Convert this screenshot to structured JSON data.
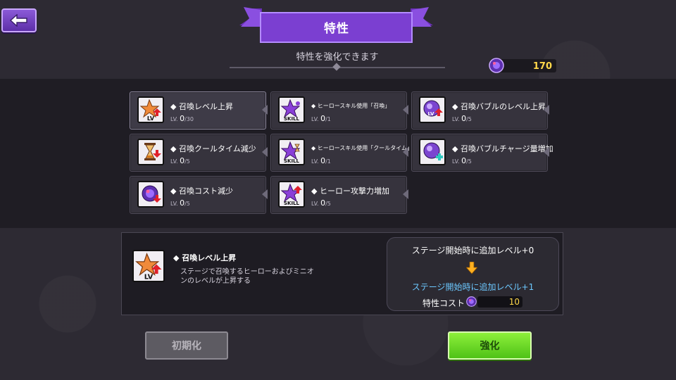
{
  "header": {
    "title": "特性",
    "subtitle": "特性を強化できます"
  },
  "currency": {
    "value": "170",
    "icon": "summon-orb-icon"
  },
  "traits": [
    {
      "name": "召喚レベル上昇",
      "lv_prefix": "LV.",
      "level": "0",
      "max": "/30",
      "icon": "orange-star-lv-icon",
      "selected": true
    },
    {
      "name": "ヒーロースキル使用「召喚」",
      "lv_prefix": "LV.",
      "level": "0",
      "max": "/1",
      "icon": "purple-star-skill-icon"
    },
    {
      "name": "召喚バブルのレベル上昇",
      "lv_prefix": "LV.",
      "level": "0",
      "max": "/5",
      "icon": "bubble-lv-icon"
    },
    {
      "name": "召喚クールタイム減少",
      "lv_prefix": "LV.",
      "level": "0",
      "max": "/5",
      "icon": "hourglass-icon"
    },
    {
      "name": "ヒーロースキル使用「クールタイム」",
      "lv_prefix": "LV.",
      "level": "0",
      "max": "/1",
      "icon": "purple-star-skill-hourglass-icon"
    },
    {
      "name": "召喚バブルチャージ量増加",
      "lv_prefix": "LV.",
      "level": "0",
      "max": "/5",
      "icon": "bubble-plus-icon"
    },
    {
      "name": "召喚コスト減少",
      "lv_prefix": "LV.",
      "level": "0",
      "max": "/5",
      "icon": "orb-down-icon"
    },
    {
      "name": "ヒーロー攻撃力増加",
      "lv_prefix": "LV.",
      "level": "0",
      "max": "/5",
      "icon": "purple-star-skill-up-icon"
    }
  ],
  "detail": {
    "name": "召喚レベル上昇",
    "description": "ステージで召喚するヒーローおよびミニオンのレベルが上昇する",
    "current": "ステージ開始時に追加レベル+0",
    "next": "ステージ開始時に追加レベル+1",
    "cost_label": "特性コスト",
    "cost_value": "10"
  },
  "buttons": {
    "reset": "初期化",
    "upgrade": "強化"
  },
  "colors": {
    "accent_purple": "#7b3fd1",
    "green": "#6fe028",
    "gold": "#ffd84a",
    "blue_text": "#6cc8ff"
  }
}
